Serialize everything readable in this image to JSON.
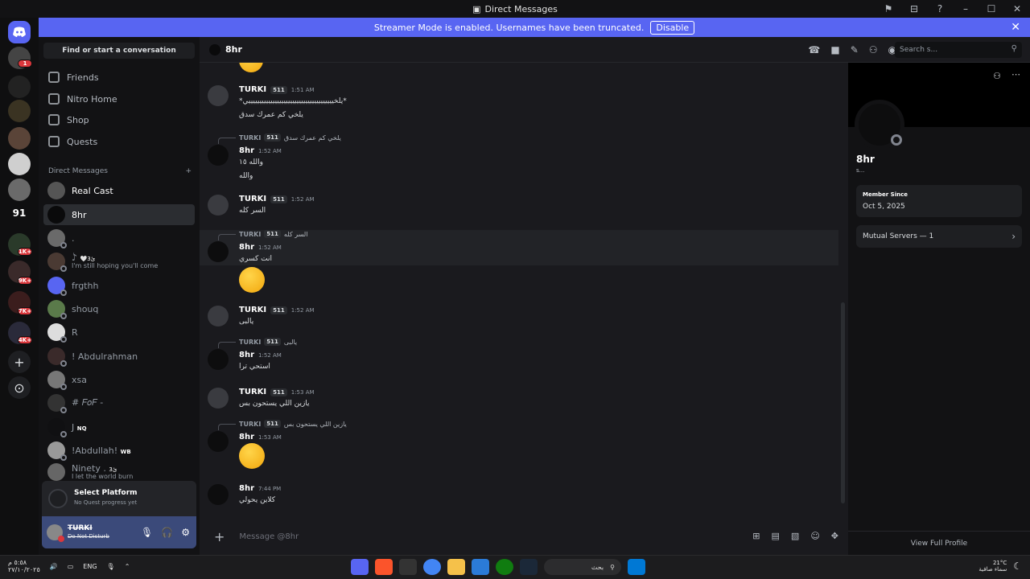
{
  "window": {
    "title": "Direct Messages"
  },
  "banner": {
    "text": "Streamer Mode is enabled. Usernames have been truncated.",
    "button": "Disable"
  },
  "sidebar": {
    "find_placeholder": "Find or start a conversation",
    "nav": [
      {
        "label": "Friends",
        "icon": "friends-icon"
      },
      {
        "label": "Nitro Home",
        "icon": "nitro-icon"
      },
      {
        "label": "Shop",
        "icon": "shop-icon"
      },
      {
        "label": "Quests",
        "icon": "quests-icon"
      }
    ],
    "dm_header": "Direct Messages",
    "dms": [
      {
        "name": "Real Cast",
        "sub": ""
      },
      {
        "name": "8hr",
        "sub": ""
      },
      {
        "name": ".",
        "sub": ""
      },
      {
        "name": "ٰ♪",
        "badge": "🤍ئ3",
        "sub": "I'm still hoping you'll come"
      },
      {
        "name": "frgthh",
        "sub": ""
      },
      {
        "name": "shouq",
        "sub": ""
      },
      {
        "name": "R",
        "sub": ""
      },
      {
        "name": "! Abdulrahman",
        "sub": ""
      },
      {
        "name": "xsa",
        "sub": ""
      },
      {
        "name": "# 𝐹𝑜𝐹 -",
        "sub": ""
      },
      {
        "name": "J",
        "badge": "NQ",
        "sub": ""
      },
      {
        "name": "!Abdullah!",
        "badge": "WB",
        "sub": ""
      },
      {
        "name": "Ninety .",
        "badge": "ئ3",
        "sub": "I let the world burn"
      }
    ],
    "quest": {
      "title": "Select Platform",
      "sub": "No Quest progress yet"
    },
    "user": {
      "name": "TURKI",
      "status": "Do Not Disturb"
    }
  },
  "server_badges": [
    "1",
    "1K+",
    "9K+",
    "7K+",
    "4K+"
  ],
  "server_label": "91",
  "channel": {
    "name": "8hr",
    "search_placeholder": "Search s..."
  },
  "messages": [
    {
      "author": "TURKI",
      "tag": "511",
      "time": "1:51 AM",
      "lines": [
        "*يلخيييييييييييييييييييييييييييييييييييييييي*",
        "يلخي كم عمرك سدق"
      ]
    },
    {
      "reply_author": "TURKI",
      "reply_tag": "511",
      "reply_text": "يلخي كم عمرك سدق",
      "author": "8hr",
      "time": "1:52 AM",
      "lines": [
        "والله ١٥",
        "والله"
      ]
    },
    {
      "author": "TURKI",
      "tag": "511",
      "time": "1:52 AM",
      "lines": [
        "السر كله"
      ]
    },
    {
      "reply_author": "TURKI",
      "reply_tag": "511",
      "reply_text": "السر كله",
      "author": "8hr",
      "time": "1:52 AM",
      "lines": [
        "انت كسري"
      ]
    },
    {
      "author": "TURKI",
      "tag": "511",
      "time": "1:52 AM",
      "lines": [
        "يالبى"
      ]
    },
    {
      "reply_author": "TURKI",
      "reply_tag": "511",
      "reply_text": "يالبى",
      "author": "8hr",
      "time": "1:52 AM",
      "lines": [
        "استحي ترا"
      ]
    },
    {
      "author": "TURKI",
      "tag": "511",
      "time": "1:53 AM",
      "lines": [
        "يازين اللي يستحون بس"
      ]
    },
    {
      "reply_author": "TURKI",
      "reply_tag": "511",
      "reply_text": "يازين اللي يستحون بس",
      "author": "8hr",
      "time": "1:53 AM",
      "lines": []
    },
    {
      "author": "8hr",
      "time": "7:44 PM",
      "lines": [
        "كلاين يحولي"
      ]
    }
  ],
  "composer": {
    "placeholder": "Message @8hr"
  },
  "profile": {
    "name": "8hr",
    "username": "s...",
    "member_since_label": "Member Since",
    "member_since": "Oct 5, 2025",
    "mutual": "Mutual Servers — 1",
    "view_full": "View Full Profile"
  },
  "taskbar": {
    "lang": "ENG",
    "search": "بحث",
    "time": "٥:٥٨ م",
    "date": "٢٧/١٠/٢٠٢٥",
    "temp": "21°C",
    "weather": "سماء صافية"
  },
  "colors": {
    "accent": "#5865f2",
    "dnd": "#da373c",
    "bg": "#1a1a1e"
  }
}
